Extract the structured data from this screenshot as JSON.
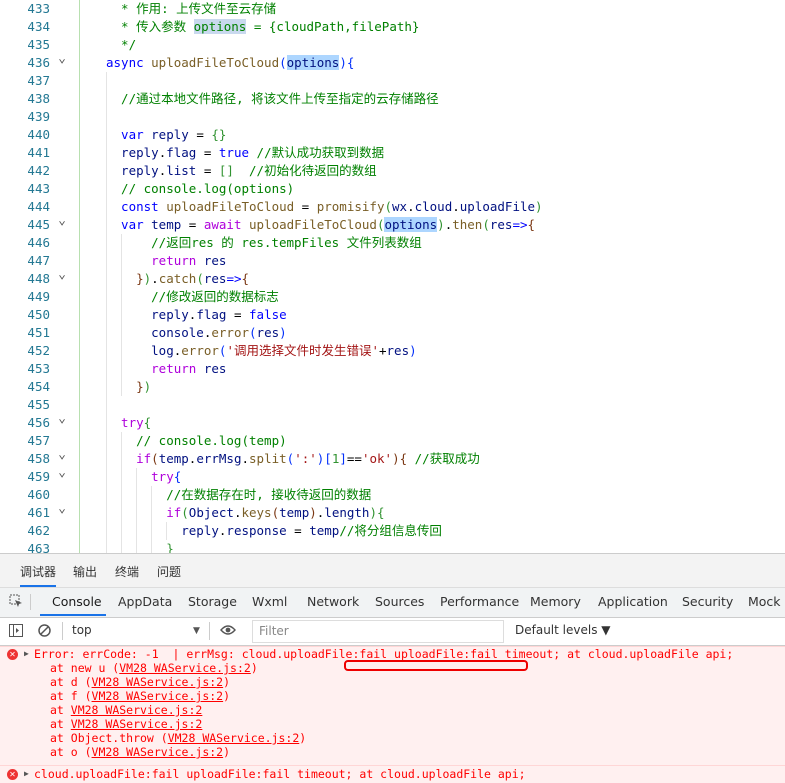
{
  "editor": {
    "lines": [
      {
        "n": "433",
        "segs": [
          {
            "t": "  * 作用: 上传文件至云存储",
            "c": "cm"
          }
        ],
        "indent": 1
      },
      {
        "n": "434",
        "segs": [
          {
            "t": "  * 传入参数 ",
            "c": "cm"
          },
          {
            "t": "options",
            "c": "cm hl2"
          },
          {
            "t": " = {cloudPath,filePath}",
            "c": "cm"
          }
        ],
        "indent": 1
      },
      {
        "n": "435",
        "segs": [
          {
            "t": "  */",
            "c": "cm"
          }
        ],
        "indent": 1
      },
      {
        "n": "436",
        "segs": [
          {
            "t": "async ",
            "c": "kw"
          },
          {
            "t": "uploadFileToCloud",
            "c": "fn"
          },
          {
            "t": "(",
            "c": "p1"
          },
          {
            "t": "options",
            "c": "var hl"
          },
          {
            "t": ")",
            "c": "p1"
          },
          {
            "t": "{",
            "c": "p1"
          }
        ],
        "indent": 1,
        "fold": true
      },
      {
        "n": "437",
        "segs": [],
        "indent": 2
      },
      {
        "n": "438",
        "segs": [
          {
            "t": "  //通过本地文件路径, 将该文件上传至指定的云存储路径",
            "c": "cm"
          }
        ],
        "indent": 2
      },
      {
        "n": "439",
        "segs": [],
        "indent": 2
      },
      {
        "n": "440",
        "segs": [
          {
            "t": "  var ",
            "c": "kw"
          },
          {
            "t": "reply",
            "c": "var"
          },
          {
            "t": " = ",
            "c": "pl"
          },
          {
            "t": "{}",
            "c": "p2"
          }
        ],
        "indent": 2
      },
      {
        "n": "441",
        "segs": [
          {
            "t": "  reply",
            "c": "var"
          },
          {
            "t": ".",
            "c": "pl"
          },
          {
            "t": "flag",
            "c": "var"
          },
          {
            "t": " = ",
            "c": "pl"
          },
          {
            "t": "true",
            "c": "cn"
          },
          {
            "t": " //默认成功获取到数据",
            "c": "cm"
          }
        ],
        "indent": 2
      },
      {
        "n": "442",
        "segs": [
          {
            "t": "  reply",
            "c": "var"
          },
          {
            "t": ".",
            "c": "pl"
          },
          {
            "t": "list",
            "c": "var"
          },
          {
            "t": " = ",
            "c": "pl"
          },
          {
            "t": "[]",
            "c": "p2"
          },
          {
            "t": "  //初始化待返回的数组",
            "c": "cm"
          }
        ],
        "indent": 2
      },
      {
        "n": "443",
        "segs": [
          {
            "t": "  // console.log(options)",
            "c": "cm"
          }
        ],
        "indent": 2
      },
      {
        "n": "444",
        "segs": [
          {
            "t": "  const ",
            "c": "kw"
          },
          {
            "t": "uploadFileToCloud",
            "c": "fn"
          },
          {
            "t": " = ",
            "c": "pl"
          },
          {
            "t": "promisify",
            "c": "fn"
          },
          {
            "t": "(",
            "c": "p2"
          },
          {
            "t": "wx",
            "c": "var"
          },
          {
            "t": ".",
            "c": "pl"
          },
          {
            "t": "cloud",
            "c": "var"
          },
          {
            "t": ".",
            "c": "pl"
          },
          {
            "t": "uploadFile",
            "c": "var"
          },
          {
            "t": ")",
            "c": "p2"
          }
        ],
        "indent": 2
      },
      {
        "n": "445",
        "segs": [
          {
            "t": "  var ",
            "c": "kw"
          },
          {
            "t": "temp",
            "c": "var"
          },
          {
            "t": " = ",
            "c": "pl"
          },
          {
            "t": "await ",
            "c": "kw2"
          },
          {
            "t": "uploadFileToCloud",
            "c": "fn"
          },
          {
            "t": "(",
            "c": "p2"
          },
          {
            "t": "options",
            "c": "var hl"
          },
          {
            "t": ")",
            "c": "p2"
          },
          {
            "t": ".",
            "c": "pl"
          },
          {
            "t": "then",
            "c": "fn"
          },
          {
            "t": "(",
            "c": "p2"
          },
          {
            "t": "res",
            "c": "var"
          },
          {
            "t": "=>",
            "c": "kw"
          },
          {
            "t": "{",
            "c": "p3"
          }
        ],
        "indent": 2,
        "fold": true
      },
      {
        "n": "446",
        "segs": [
          {
            "t": "      //返回res 的 res.tempFiles 文件列表数组",
            "c": "cm"
          }
        ],
        "indent": 3
      },
      {
        "n": "447",
        "segs": [
          {
            "t": "      return ",
            "c": "kw2"
          },
          {
            "t": "res",
            "c": "var"
          }
        ],
        "indent": 3
      },
      {
        "n": "448",
        "segs": [
          {
            "t": "    }",
            "c": "p3"
          },
          {
            "t": ")",
            "c": "p2"
          },
          {
            "t": ".",
            "c": "pl"
          },
          {
            "t": "catch",
            "c": "fn"
          },
          {
            "t": "(",
            "c": "p2"
          },
          {
            "t": "res",
            "c": "var"
          },
          {
            "t": "=>",
            "c": "kw"
          },
          {
            "t": "{",
            "c": "p3"
          }
        ],
        "indent": 3,
        "fold": true
      },
      {
        "n": "449",
        "segs": [
          {
            "t": "      //修改返回的数据标志",
            "c": "cm"
          }
        ],
        "indent": 3
      },
      {
        "n": "450",
        "segs": [
          {
            "t": "      reply",
            "c": "var"
          },
          {
            "t": ".",
            "c": "pl"
          },
          {
            "t": "flag",
            "c": "var"
          },
          {
            "t": " = ",
            "c": "pl"
          },
          {
            "t": "false",
            "c": "cn"
          }
        ],
        "indent": 3
      },
      {
        "n": "451",
        "segs": [
          {
            "t": "      console",
            "c": "var"
          },
          {
            "t": ".",
            "c": "pl"
          },
          {
            "t": "error",
            "c": "fn"
          },
          {
            "t": "(",
            "c": "p1"
          },
          {
            "t": "res",
            "c": "var"
          },
          {
            "t": ")",
            "c": "p1"
          }
        ],
        "indent": 3
      },
      {
        "n": "452",
        "segs": [
          {
            "t": "      log",
            "c": "var"
          },
          {
            "t": ".",
            "c": "pl"
          },
          {
            "t": "error",
            "c": "fn"
          },
          {
            "t": "(",
            "c": "p1"
          },
          {
            "t": "'调用选择文件时发生错误'",
            "c": "str"
          },
          {
            "t": "+",
            "c": "pl"
          },
          {
            "t": "res",
            "c": "var"
          },
          {
            "t": ")",
            "c": "p1"
          }
        ],
        "indent": 3
      },
      {
        "n": "453",
        "segs": [
          {
            "t": "      return ",
            "c": "kw2"
          },
          {
            "t": "res",
            "c": "var"
          }
        ],
        "indent": 3
      },
      {
        "n": "454",
        "segs": [
          {
            "t": "    }",
            "c": "p3"
          },
          {
            "t": ")",
            "c": "p2"
          }
        ],
        "indent": 3
      },
      {
        "n": "455",
        "segs": [],
        "indent": 2
      },
      {
        "n": "456",
        "segs": [
          {
            "t": "  try",
            "c": "kw2"
          },
          {
            "t": "{",
            "c": "p2"
          }
        ],
        "indent": 2,
        "fold": true
      },
      {
        "n": "457",
        "segs": [
          {
            "t": "    // console.log(temp)",
            "c": "cm"
          }
        ],
        "indent": 3
      },
      {
        "n": "458",
        "segs": [
          {
            "t": "    if",
            "c": "kw2"
          },
          {
            "t": "(",
            "c": "p3"
          },
          {
            "t": "temp",
            "c": "var"
          },
          {
            "t": ".",
            "c": "pl"
          },
          {
            "t": "errMsg",
            "c": "var"
          },
          {
            "t": ".",
            "c": "pl"
          },
          {
            "t": "split",
            "c": "fn"
          },
          {
            "t": "(",
            "c": "p1"
          },
          {
            "t": "':'",
            "c": "str"
          },
          {
            "t": ")",
            "c": "p1"
          },
          {
            "t": "[",
            "c": "p1"
          },
          {
            "t": "1",
            "c": "p2"
          },
          {
            "t": "]",
            "c": "p1"
          },
          {
            "t": "==",
            "c": "pl"
          },
          {
            "t": "'ok'",
            "c": "str"
          },
          {
            "t": ")",
            "c": "p3"
          },
          {
            "t": "{",
            "c": "p3"
          },
          {
            "t": " //获取成功",
            "c": "cm"
          }
        ],
        "indent": 3,
        "fold": true
      },
      {
        "n": "459",
        "segs": [
          {
            "t": "      try",
            "c": "kw2"
          },
          {
            "t": "{",
            "c": "p1"
          }
        ],
        "indent": 4,
        "fold": true
      },
      {
        "n": "460",
        "segs": [
          {
            "t": "        //在数据存在时, 接收待返回的数据",
            "c": "cm"
          }
        ],
        "indent": 5
      },
      {
        "n": "461",
        "segs": [
          {
            "t": "        if",
            "c": "kw2"
          },
          {
            "t": "(",
            "c": "p2"
          },
          {
            "t": "Object",
            "c": "var"
          },
          {
            "t": ".",
            "c": "pl"
          },
          {
            "t": "keys",
            "c": "fn"
          },
          {
            "t": "(",
            "c": "p3"
          },
          {
            "t": "temp",
            "c": "var"
          },
          {
            "t": ")",
            "c": "p3"
          },
          {
            "t": ".",
            "c": "pl"
          },
          {
            "t": "length",
            "c": "var"
          },
          {
            "t": ")",
            "c": "p2"
          },
          {
            "t": "{",
            "c": "p2"
          }
        ],
        "indent": 5,
        "fold": true
      },
      {
        "n": "462",
        "segs": [
          {
            "t": "          reply",
            "c": "var"
          },
          {
            "t": ".",
            "c": "pl"
          },
          {
            "t": "response",
            "c": "var"
          },
          {
            "t": " = ",
            "c": "pl"
          },
          {
            "t": "temp",
            "c": "var"
          },
          {
            "t": "//将分组信息传回",
            "c": "cm"
          }
        ],
        "indent": 6
      },
      {
        "n": "463",
        "segs": [
          {
            "t": "        }",
            "c": "p2"
          }
        ],
        "indent": 5
      }
    ]
  },
  "panel": {
    "top_tabs": [
      "调试器",
      "输出",
      "终端",
      "问题"
    ],
    "devtools_tabs": [
      "Console",
      "AppData",
      "Storage",
      "Wxml",
      "Network",
      "Sources",
      "Performance",
      "Memory",
      "Application",
      "Security",
      "Mock"
    ],
    "context": "top",
    "filter_placeholder": "Filter",
    "levels": "Default levels ▼"
  },
  "console": {
    "error1": {
      "head": "Error: errCode: -1  | errMsg: cloud.uploadFile:fail uploadFile:fail timeout; at cloud.uploadFile api;",
      "stack": [
        {
          "pre": "at new u (",
          "link": "VM28 WAService.js:2",
          "post": ")"
        },
        {
          "pre": "at d (",
          "link": "VM28 WAService.js:2",
          "post": ")"
        },
        {
          "pre": "at f (",
          "link": "VM28 WAService.js:2",
          "post": ")"
        },
        {
          "pre": "at ",
          "link": "VM28 WAService.js:2",
          "post": ""
        },
        {
          "pre": "at ",
          "link": "VM28 WAService.js:2",
          "post": ""
        },
        {
          "pre": "at Object.throw (",
          "link": "VM28 WAService.js:2",
          "post": ")"
        },
        {
          "pre": "at o (",
          "link": "VM28 WAService.js:2",
          "post": ")"
        }
      ]
    },
    "error2": "cloud.uploadFile:fail uploadFile:fail timeout; at cloud.uploadFile api;"
  }
}
